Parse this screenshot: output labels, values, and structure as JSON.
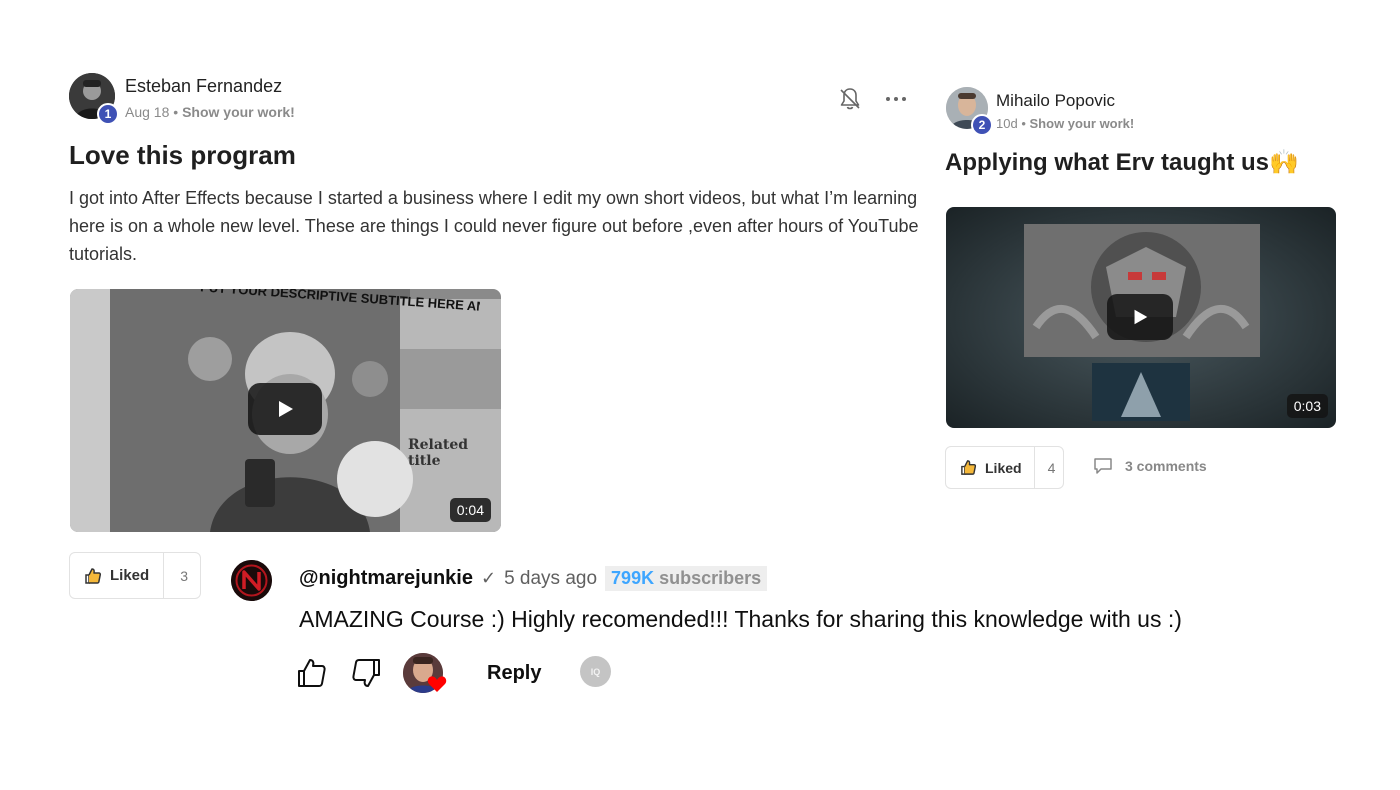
{
  "post_main": {
    "author": "Esteban Fernandez",
    "rank": "1",
    "date": "Aug 18",
    "separator": "•",
    "category": "Show your work!",
    "title": "Love this program",
    "body": "I got into After Effects because I started a business where I edit my own short videos, but what I’m learning here is on a whole new level. These are things I could never figure out before ,even after hours of YouTube tutorials.",
    "video": {
      "duration": "0:04",
      "poster_text_top": "PUT YOUR DESCRIPTIVE SUBTITLE HERE AND MAKE IT FIT",
      "poster_text_side": "Related title"
    },
    "like": {
      "label": "Liked",
      "count": "3"
    }
  },
  "post_side": {
    "author": "Mihailo Popovic",
    "rank": "2",
    "date": "10d",
    "separator": "•",
    "category": "Show your work!",
    "title": "Applying what Erv taught us🙌",
    "video": {
      "duration": "0:03"
    },
    "like": {
      "label": "Liked",
      "count": "4"
    },
    "comments": "3 comments"
  },
  "yt_comment": {
    "handle": "@nightmarejunkie",
    "verified": "✓",
    "time": "5 days ago",
    "subs_count": "799K",
    "subs_label": "subscribers",
    "text": "AMAZING Course :) Highly recomended!!! Thanks for sharing this knowledge with us :)",
    "reply_label": "Reply",
    "badge": "IQ"
  },
  "icons": {
    "bell": "bell-off-icon",
    "more": "more-horizontal-icon",
    "thumb": "thumbs-up-icon",
    "comment": "comment-icon",
    "dislike": "thumbs-down-icon",
    "heart": "heart-icon",
    "play": "play-icon"
  },
  "colors": {
    "rank_badge": "#3f51b5",
    "yt_subs_count": "#3ea6ff",
    "heart": "#ff0000"
  }
}
